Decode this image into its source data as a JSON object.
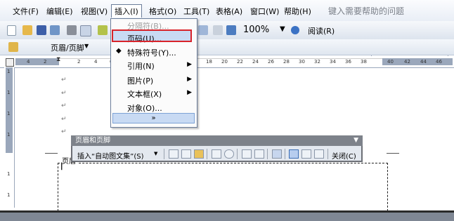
{
  "menubar": {
    "items": [
      {
        "label": "文件(F)"
      },
      {
        "label": "编辑(E)"
      },
      {
        "label": "视图(V)"
      },
      {
        "label": "插入(I)"
      },
      {
        "label": "格式(O)"
      },
      {
        "label": "工具(T)"
      },
      {
        "label": "表格(A)"
      },
      {
        "label": "窗口(W)"
      },
      {
        "label": "帮助(H)"
      }
    ],
    "help_prompt": "键入需要帮助的问题"
  },
  "toolbar1": {
    "zoom": "100%",
    "read_label": "阅读(R)",
    "font": "宋体"
  },
  "toolbar2": {
    "header_footer_label": "页眉/页脚"
  },
  "ruler": {
    "h_numbers": [
      "4",
      "2",
      "2",
      "4",
      "6",
      "8",
      "10",
      "12",
      "14",
      "16",
      "18",
      "20",
      "22",
      "24",
      "26",
      "28",
      "30",
      "32",
      "34",
      "36",
      "38",
      "40",
      "42",
      "44",
      "46"
    ],
    "v_numbers": [
      "1",
      "1",
      "1",
      "1",
      "1",
      "1",
      "1",
      "1"
    ]
  },
  "insert_menu": {
    "items": [
      {
        "label": "分隔符(B)...",
        "disabled": true
      },
      {
        "label": "页码(U)...",
        "highlighted": true
      },
      {
        "label": "特殊符号(Y)..."
      },
      {
        "label": "引用(N)",
        "submenu": true
      },
      {
        "label": "图片(P)",
        "submenu": true
      },
      {
        "label": "文本框(X)",
        "submenu": true
      },
      {
        "label": "对象(O)..."
      }
    ],
    "expand_icon": "chevron-double-down-icon"
  },
  "header_footer_toolbar": {
    "title": "页眉和页脚",
    "insert_autotext": "插入“自动图文集”(S)",
    "close_label": "关闭(C)"
  },
  "document": {
    "header_label": "页眉"
  }
}
